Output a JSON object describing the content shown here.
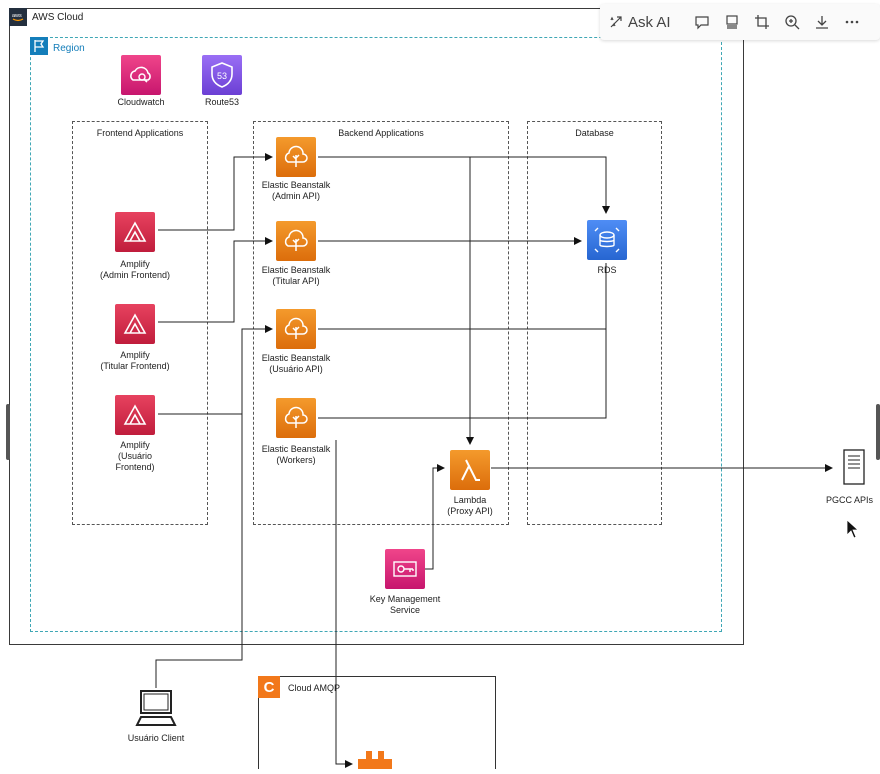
{
  "toolbar": {
    "ask_ai_label": "Ask AI",
    "icons": [
      "ask-ai-icon",
      "comment-icon",
      "present-icon",
      "crop-icon",
      "zoom-in-icon",
      "download-icon",
      "more-icon"
    ]
  },
  "containers": {
    "aws_cloud": "AWS Cloud",
    "region": "Region",
    "frontend": "Frontend Applications",
    "backend": "Backend Applications",
    "database": "Database",
    "cloud_amqp": "Cloud AMQP"
  },
  "services": {
    "cloudwatch": "Cloudwatch",
    "route53": "Route53",
    "route53_badge": "53",
    "amp_admin_1": "Amplify",
    "amp_admin_2": "(Admin Frontend)",
    "amp_titular_1": "Amplify",
    "amp_titular_2": "(Titular Frontend)",
    "amp_usuario_1": "Amplify",
    "amp_usuario_2": "(Usuário",
    "amp_usuario_3": "Frontend)",
    "eb_admin_1": "Elastic Beanstalk",
    "eb_admin_2": "(Admin API)",
    "eb_titular_1": "Elastic Beanstalk",
    "eb_titular_2": "(Titular API)",
    "eb_usuario_1": "Elastic Beanstalk",
    "eb_usuario_2": "(Usuário API)",
    "eb_workers_1": "Elastic Beanstalk",
    "eb_workers_2": "(Workers)",
    "rds": "RDS",
    "lambda_1": "Lambda",
    "lambda_2": "(Proxy API)",
    "kms_1": "Key Management",
    "kms_2": "Service",
    "pgcc": "PGCC APIs",
    "usuario_client": "Usuário Client",
    "amqp_badge": "C"
  },
  "colors": {
    "amplify": "#d8304f",
    "beanstalk": "#e8801a",
    "rds": "#3b7ce5",
    "kms": "#dd2c63",
    "route53": "#8251e8",
    "region": "#147eba",
    "amqp": "#f2781a"
  }
}
